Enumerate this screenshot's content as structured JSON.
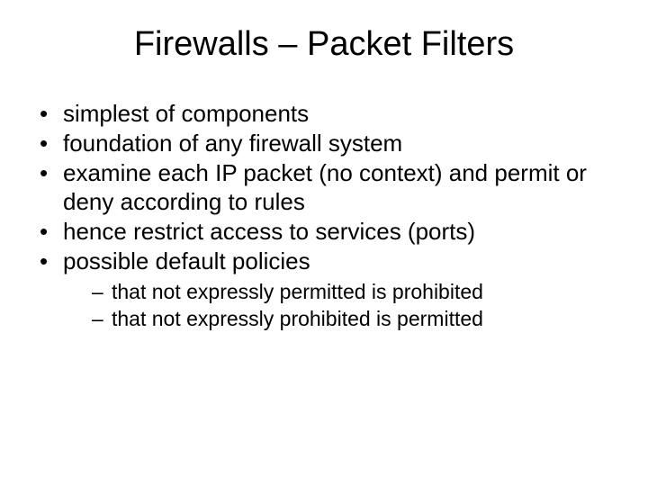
{
  "title": "Firewalls – Packet Filters",
  "bullets": [
    "simplest of components",
    "foundation of any firewall system",
    "examine each IP packet (no context) and permit or deny according to rules",
    "hence restrict access to services (ports)",
    "possible default policies"
  ],
  "sub_bullets": [
    "that not expressly permitted is prohibited",
    "that not expressly prohibited is permitted"
  ]
}
